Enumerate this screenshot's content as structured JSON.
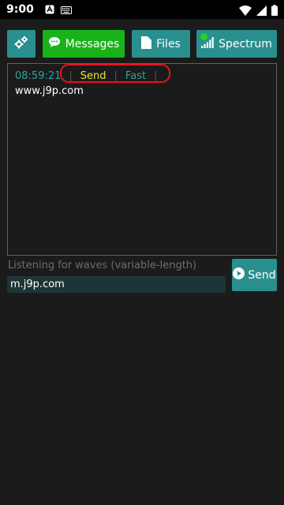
{
  "status_bar": {
    "time": "9:00",
    "icons": [
      "a-badge-icon",
      "keyboard-icon",
      "wifi-icon",
      "signal-icon",
      "battery-icon"
    ]
  },
  "toolbar": {
    "settings_icon": "gears-icon",
    "messages_label": "Messages",
    "files_label": "Files",
    "spectrum_label": "Spectrum",
    "active_color": "#19b21a",
    "button_color": "#2a8f8f"
  },
  "message": {
    "time": "08:59:21",
    "sep1": "|",
    "mode": "Send",
    "sep2": "|",
    "speed": "Fast",
    "sep3": "|",
    "text": "www.j9p.com"
  },
  "composer": {
    "listening_label": "Listening for waves (variable-length)",
    "input_value": "m.j9p.com",
    "send_label": "Send"
  },
  "highlight_color": "#e8121d"
}
